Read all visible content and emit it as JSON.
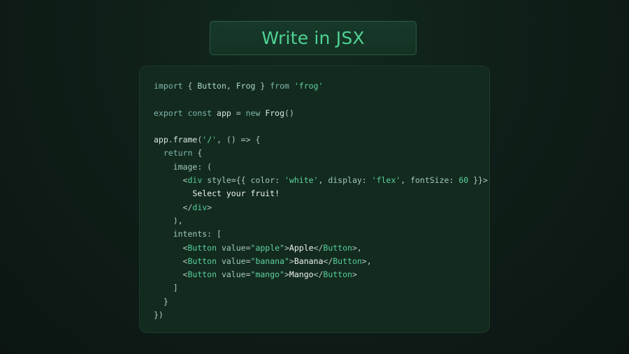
{
  "title": "Write in JSX",
  "code_lines": [
    [
      {
        "t": "import",
        "c": "kw"
      },
      {
        "t": " { ",
        "c": "pun"
      },
      {
        "t": "Button",
        "c": "cls"
      },
      {
        "t": ", ",
        "c": "pun"
      },
      {
        "t": "Frog",
        "c": "cls"
      },
      {
        "t": " } ",
        "c": "pun"
      },
      {
        "t": "from",
        "c": "kw"
      },
      {
        "t": " ",
        "c": "pun"
      },
      {
        "t": "'frog'",
        "c": "str"
      }
    ],
    [],
    [
      {
        "t": "export",
        "c": "kw"
      },
      {
        "t": " ",
        "c": "pun"
      },
      {
        "t": "const",
        "c": "kw"
      },
      {
        "t": " ",
        "c": "pun"
      },
      {
        "t": "app",
        "c": "id"
      },
      {
        "t": " = ",
        "c": "pun"
      },
      {
        "t": "new",
        "c": "kw"
      },
      {
        "t": " ",
        "c": "pun"
      },
      {
        "t": "Frog",
        "c": "id"
      },
      {
        "t": "()",
        "c": "pun"
      }
    ],
    [],
    [
      {
        "t": "app",
        "c": "id"
      },
      {
        "t": ".",
        "c": "pun"
      },
      {
        "t": "frame",
        "c": "id"
      },
      {
        "t": "(",
        "c": "pun"
      },
      {
        "t": "'/'",
        "c": "str"
      },
      {
        "t": ", () => {",
        "c": "pun"
      }
    ],
    [
      {
        "t": "  ",
        "c": "pun"
      },
      {
        "t": "return",
        "c": "kw"
      },
      {
        "t": " {",
        "c": "pun"
      }
    ],
    [
      {
        "t": "    ",
        "c": "pun"
      },
      {
        "t": "image",
        "c": "attr"
      },
      {
        "t": ": (",
        "c": "pun"
      }
    ],
    [
      {
        "t": "      <",
        "c": "pun"
      },
      {
        "t": "div",
        "c": "tag"
      },
      {
        "t": " ",
        "c": "pun"
      },
      {
        "t": "style",
        "c": "attr"
      },
      {
        "t": "={{ ",
        "c": "pun"
      },
      {
        "t": "color",
        "c": "attr"
      },
      {
        "t": ": ",
        "c": "pun"
      },
      {
        "t": "'white'",
        "c": "str"
      },
      {
        "t": ", ",
        "c": "pun"
      },
      {
        "t": "display",
        "c": "attr"
      },
      {
        "t": ": ",
        "c": "pun"
      },
      {
        "t": "'flex'",
        "c": "str"
      },
      {
        "t": ", ",
        "c": "pun"
      },
      {
        "t": "fontSize",
        "c": "attr"
      },
      {
        "t": ": ",
        "c": "pun"
      },
      {
        "t": "60",
        "c": "num"
      },
      {
        "t": " }}>",
        "c": "pun"
      }
    ],
    [
      {
        "t": "        ",
        "c": "pun"
      },
      {
        "t": "Select your fruit!",
        "c": "txt"
      }
    ],
    [
      {
        "t": "      </",
        "c": "pun"
      },
      {
        "t": "div",
        "c": "tag"
      },
      {
        "t": ">",
        "c": "pun"
      }
    ],
    [
      {
        "t": "    ),",
        "c": "pun"
      }
    ],
    [
      {
        "t": "    ",
        "c": "pun"
      },
      {
        "t": "intents",
        "c": "attr"
      },
      {
        "t": ": [",
        "c": "pun"
      }
    ],
    [
      {
        "t": "      <",
        "c": "pun"
      },
      {
        "t": "Button",
        "c": "tag"
      },
      {
        "t": " ",
        "c": "pun"
      },
      {
        "t": "value",
        "c": "attr"
      },
      {
        "t": "=",
        "c": "pun"
      },
      {
        "t": "\"apple\"",
        "c": "str"
      },
      {
        "t": ">",
        "c": "pun"
      },
      {
        "t": "Apple",
        "c": "txt"
      },
      {
        "t": "</",
        "c": "pun"
      },
      {
        "t": "Button",
        "c": "tag"
      },
      {
        "t": ">,",
        "c": "pun"
      }
    ],
    [
      {
        "t": "      <",
        "c": "pun"
      },
      {
        "t": "Button",
        "c": "tag"
      },
      {
        "t": " ",
        "c": "pun"
      },
      {
        "t": "value",
        "c": "attr"
      },
      {
        "t": "=",
        "c": "pun"
      },
      {
        "t": "\"banana\"",
        "c": "str"
      },
      {
        "t": ">",
        "c": "pun"
      },
      {
        "t": "Banana",
        "c": "txt"
      },
      {
        "t": "</",
        "c": "pun"
      },
      {
        "t": "Button",
        "c": "tag"
      },
      {
        "t": ">,",
        "c": "pun"
      }
    ],
    [
      {
        "t": "      <",
        "c": "pun"
      },
      {
        "t": "Button",
        "c": "tag"
      },
      {
        "t": " ",
        "c": "pun"
      },
      {
        "t": "value",
        "c": "attr"
      },
      {
        "t": "=",
        "c": "pun"
      },
      {
        "t": "\"mango\"",
        "c": "str"
      },
      {
        "t": ">",
        "c": "pun"
      },
      {
        "t": "Mango",
        "c": "txt"
      },
      {
        "t": "</",
        "c": "pun"
      },
      {
        "t": "Button",
        "c": "tag"
      },
      {
        "t": ">",
        "c": "pun"
      }
    ],
    [
      {
        "t": "    ]",
        "c": "pun"
      }
    ],
    [
      {
        "t": "  }",
        "c": "pun"
      }
    ],
    [
      {
        "t": "})",
        "c": "pun"
      }
    ]
  ]
}
